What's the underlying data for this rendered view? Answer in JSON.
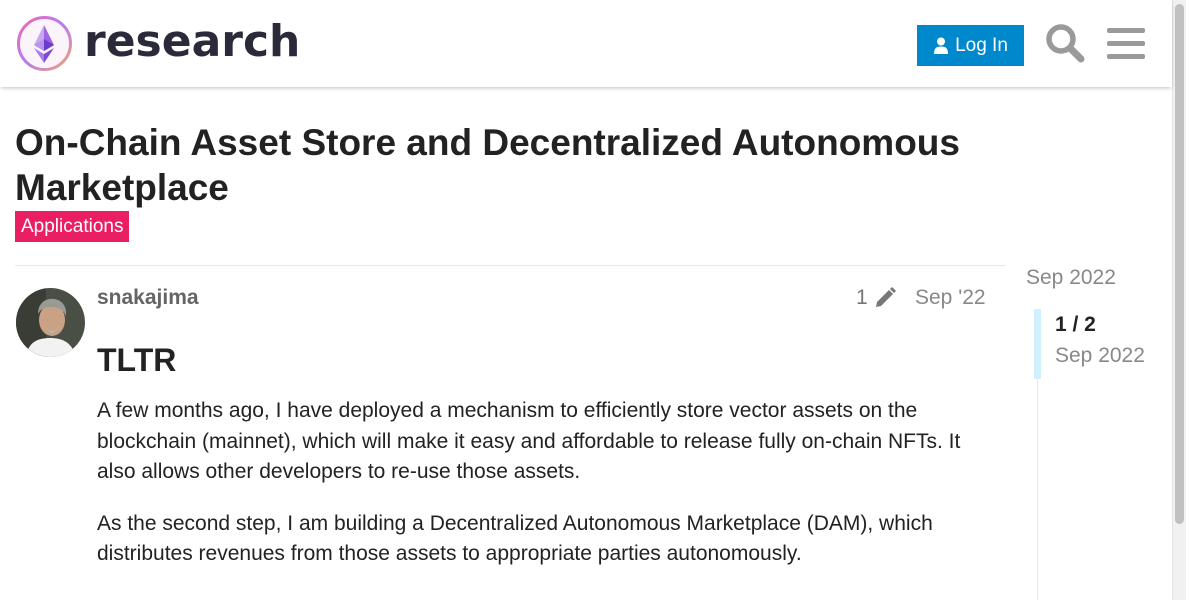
{
  "header": {
    "logo_text": "research",
    "login_label": "Log In",
    "search_icon": "search-icon",
    "menu_icon": "hamburger-menu-icon"
  },
  "colors": {
    "login_bg": "#0088cc",
    "category_bg": "#e91e63",
    "timeline_handle": "#d1f0ff"
  },
  "topic": {
    "title": "On-Chain Asset Store and Decentralized Autonomous Marketplace",
    "category": "Applications"
  },
  "post": {
    "username": "snakajima",
    "edit_count": "1",
    "date": "Sep '22",
    "heading": "TLTR",
    "paragraphs": [
      "A few months ago, I have deployed a mechanism to efficiently store vector assets on the blockchain (mainnet), which will make it easy and affordable to release fully on-chain NFTs. It also allows other developers to re-use those assets.",
      "As the second step, I am building a Decentralized Autonomous Marketplace (DAM), which distributes revenues from those assets to appropriate parties autonomously."
    ]
  },
  "timeline": {
    "top_date": "Sep 2022",
    "position": "1 / 2",
    "current_date": "Sep 2022"
  }
}
